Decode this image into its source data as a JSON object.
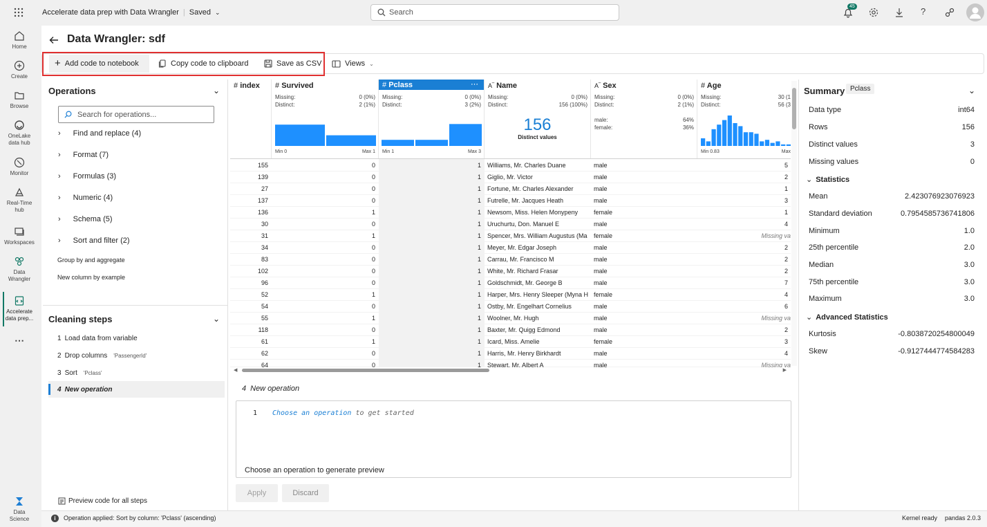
{
  "topbar": {
    "title": "Accelerate data prep with Data Wrangler",
    "saved": "Saved",
    "search_placeholder": "Search",
    "notif_count": "45"
  },
  "rail": [
    {
      "label": "Home",
      "icon": "home-icon"
    },
    {
      "label": "Create",
      "icon": "plus-circle-icon"
    },
    {
      "label": "Browse",
      "icon": "folder-icon"
    },
    {
      "label": "OneLake data hub",
      "icon": "onelake-icon"
    },
    {
      "label": "Monitor",
      "icon": "monitor-icon"
    },
    {
      "label": "Real-Time hub",
      "icon": "realtime-icon"
    },
    {
      "label": "Workspaces",
      "icon": "workspaces-icon"
    },
    {
      "label": "Data Wrangler",
      "icon": "data-wrangler-icon"
    },
    {
      "label": "Accelerate data prep...",
      "icon": "notebook-icon"
    },
    {
      "label": "Data Science",
      "icon": "data-science-icon"
    }
  ],
  "page_title": "Data Wrangler: sdf",
  "toolbar": {
    "add_code": "Add code to notebook",
    "copy_code": "Copy code to clipboard",
    "save_csv": "Save as CSV",
    "views": "Views"
  },
  "operations": {
    "title": "Operations",
    "search_placeholder": "Search for operations...",
    "groups": [
      "Find and replace (4)",
      "Format (7)",
      "Formulas (3)",
      "Numeric (4)",
      "Schema (5)",
      "Sort and filter (2)"
    ],
    "links": [
      "Group by and aggregate",
      "New column by example"
    ]
  },
  "cleaning": {
    "title": "Cleaning steps",
    "steps": [
      {
        "num": "1",
        "label": "Load data from variable",
        "arg": ""
      },
      {
        "num": "2",
        "label": "Drop columns",
        "arg": "'PassengerId'"
      },
      {
        "num": "3",
        "label": "Sort",
        "arg": "'Pclass'"
      },
      {
        "num": "4",
        "label": "New operation",
        "arg": ""
      }
    ],
    "preview_all": "Preview code for all steps"
  },
  "columns": {
    "index": {
      "name": "index"
    },
    "survived": {
      "name": "Survived",
      "missing": "0 (0%)",
      "distinct": "2 (1%)",
      "min": "Min 0",
      "max": "Max 1",
      "hist": [
        0.7,
        0.35
      ]
    },
    "pclass": {
      "name": "Pclass",
      "missing": "0 (0%)",
      "distinct": "3 (2%)",
      "min": "Min 1",
      "max": "Max 3",
      "hist": [
        0.2,
        0.2,
        0.72
      ]
    },
    "name": {
      "name": "Name",
      "missing": "0 (0%)",
      "distinct": "156 (100%)",
      "big": "156",
      "big_label": "Distinct values"
    },
    "sex": {
      "name": "Sex",
      "missing": "0 (0%)",
      "distinct": "2 (1%)",
      "cats": [
        {
          "k": "male:",
          "v": "64%"
        },
        {
          "k": "female:",
          "v": "36%"
        }
      ]
    },
    "age": {
      "name": "Age",
      "missing": "30 (1",
      "distinct": "56 (3",
      "min": "Min 0.83",
      "max": "Max",
      "hist": [
        0.25,
        0.15,
        0.55,
        0.7,
        0.85,
        1.0,
        0.75,
        0.65,
        0.45,
        0.45,
        0.4,
        0.15,
        0.2,
        0.1,
        0.15,
        0.05,
        0.05
      ]
    }
  },
  "stat_labels": {
    "missing": "Missing:",
    "distinct": "Distinct:"
  },
  "rows": [
    [
      "155",
      "0",
      "1",
      "Williams, Mr. Charles Duane",
      "male",
      "5"
    ],
    [
      "139",
      "0",
      "1",
      "Giglio, Mr. Victor",
      "male",
      "2"
    ],
    [
      "27",
      "0",
      "1",
      "Fortune, Mr. Charles Alexander",
      "male",
      "1"
    ],
    [
      "137",
      "0",
      "1",
      "Futrelle, Mr. Jacques Heath",
      "male",
      "3"
    ],
    [
      "136",
      "1",
      "1",
      "Newsom, Miss. Helen Monypeny",
      "female",
      "1"
    ],
    [
      "30",
      "0",
      "1",
      "Uruchurtu, Don. Manuel E",
      "male",
      "4"
    ],
    [
      "31",
      "1",
      "1",
      "Spencer, Mrs. William Augustus (Ma",
      "female",
      "Missing va"
    ],
    [
      "34",
      "0",
      "1",
      "Meyer, Mr. Edgar Joseph",
      "male",
      "2"
    ],
    [
      "83",
      "0",
      "1",
      "Carrau, Mr. Francisco M",
      "male",
      "2"
    ],
    [
      "102",
      "0",
      "1",
      "White, Mr. Richard Frasar",
      "male",
      "2"
    ],
    [
      "96",
      "0",
      "1",
      "Goldschmidt, Mr. George B",
      "male",
      "7"
    ],
    [
      "52",
      "1",
      "1",
      "Harper, Mrs. Henry Sleeper (Myna H",
      "female",
      "4"
    ],
    [
      "54",
      "0",
      "1",
      "Ostby, Mr. Engelhart Cornelius",
      "male",
      "6"
    ],
    [
      "55",
      "1",
      "1",
      "Woolner, Mr. Hugh",
      "male",
      "Missing va"
    ],
    [
      "118",
      "0",
      "1",
      "Baxter, Mr. Quigg Edmond",
      "male",
      "2"
    ],
    [
      "61",
      "1",
      "1",
      "Icard, Miss. Amelie",
      "female",
      "3"
    ],
    [
      "62",
      "0",
      "1",
      "Harris, Mr. Henry Birkhardt",
      "male",
      "4"
    ],
    [
      "64",
      "0",
      "1",
      "Stewart, Mr. Albert A",
      "male",
      "Missing va"
    ]
  ],
  "editor": {
    "header_num": "4",
    "header_label": "New operation",
    "line_num": "1",
    "code_a": "Choose",
    "code_b": "an",
    "code_c": "operation",
    "code_d": "to get started",
    "preview_msg": "Choose an operation to generate preview",
    "apply": "Apply",
    "discard": "Discard"
  },
  "summary": {
    "title": "Summary",
    "column_badge": "Pclass",
    "basic": [
      {
        "k": "Data type",
        "v": "int64"
      },
      {
        "k": "Rows",
        "v": "156"
      },
      {
        "k": "Distinct values",
        "v": "3"
      },
      {
        "k": "Missing values",
        "v": "0"
      }
    ],
    "stats_title": "Statistics",
    "stats": [
      {
        "k": "Mean",
        "v": "2.423076923076923"
      },
      {
        "k": "Standard deviation",
        "v": "0.7954585736741806"
      },
      {
        "k": "Minimum",
        "v": "1.0"
      },
      {
        "k": "25th percentile",
        "v": "2.0"
      },
      {
        "k": "Median",
        "v": "3.0"
      },
      {
        "k": "75th percentile",
        "v": "3.0"
      },
      {
        "k": "Maximum",
        "v": "3.0"
      }
    ],
    "adv_title": "Advanced Statistics",
    "adv": [
      {
        "k": "Kurtosis",
        "v": "-0.8038720254800049"
      },
      {
        "k": "Skew",
        "v": "-0.9127444774584283"
      }
    ]
  },
  "status": {
    "message": "Operation applied: Sort by column: 'Pclass' (ascending)",
    "kernel": "Kernel ready",
    "pandas": "pandas 2.0.3"
  },
  "colors": {
    "accent": "#1e90ff",
    "selected_header": "#1a7fd4",
    "red_box": "#e03030",
    "brand_green": "#117865"
  }
}
